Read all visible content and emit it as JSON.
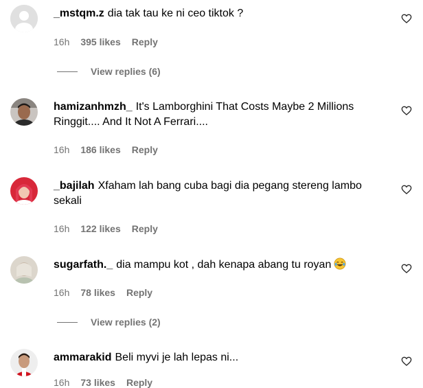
{
  "comments": [
    {
      "username": "_mstqm.z",
      "text": "dia tak tau ke ni ceo tiktok ?",
      "time": "16h",
      "likes": "395 likes",
      "reply": "Reply",
      "view_replies": "View replies (6)"
    },
    {
      "username": "hamizanhmzh_",
      "text": "It's Lamborghini That Costs Maybe 2 Millions Ringgit.... And It Not A Ferrari....",
      "time": "16h",
      "likes": "186 likes",
      "reply": "Reply"
    },
    {
      "username": "_bajilah",
      "text": "Xfaham lah bang cuba bagi dia pegang stereng lambo sekali",
      "time": "16h",
      "likes": "122 likes",
      "reply": "Reply"
    },
    {
      "username": "sugarfath._",
      "text": "dia mampu kot , dah kenapa abang tu royan",
      "emoji": "laughing-tears-emoji",
      "time": "16h",
      "likes": "78 likes",
      "reply": "Reply",
      "view_replies": "View replies (2)"
    },
    {
      "username": "ammarakid",
      "text": "Beli myvi je lah lepas ni...",
      "time": "16h",
      "likes": "73 likes",
      "reply": "Reply"
    }
  ],
  "icons": {
    "like": "heart-outline-icon"
  },
  "colors": {
    "meta_text": "#737373",
    "text": "#000000"
  }
}
